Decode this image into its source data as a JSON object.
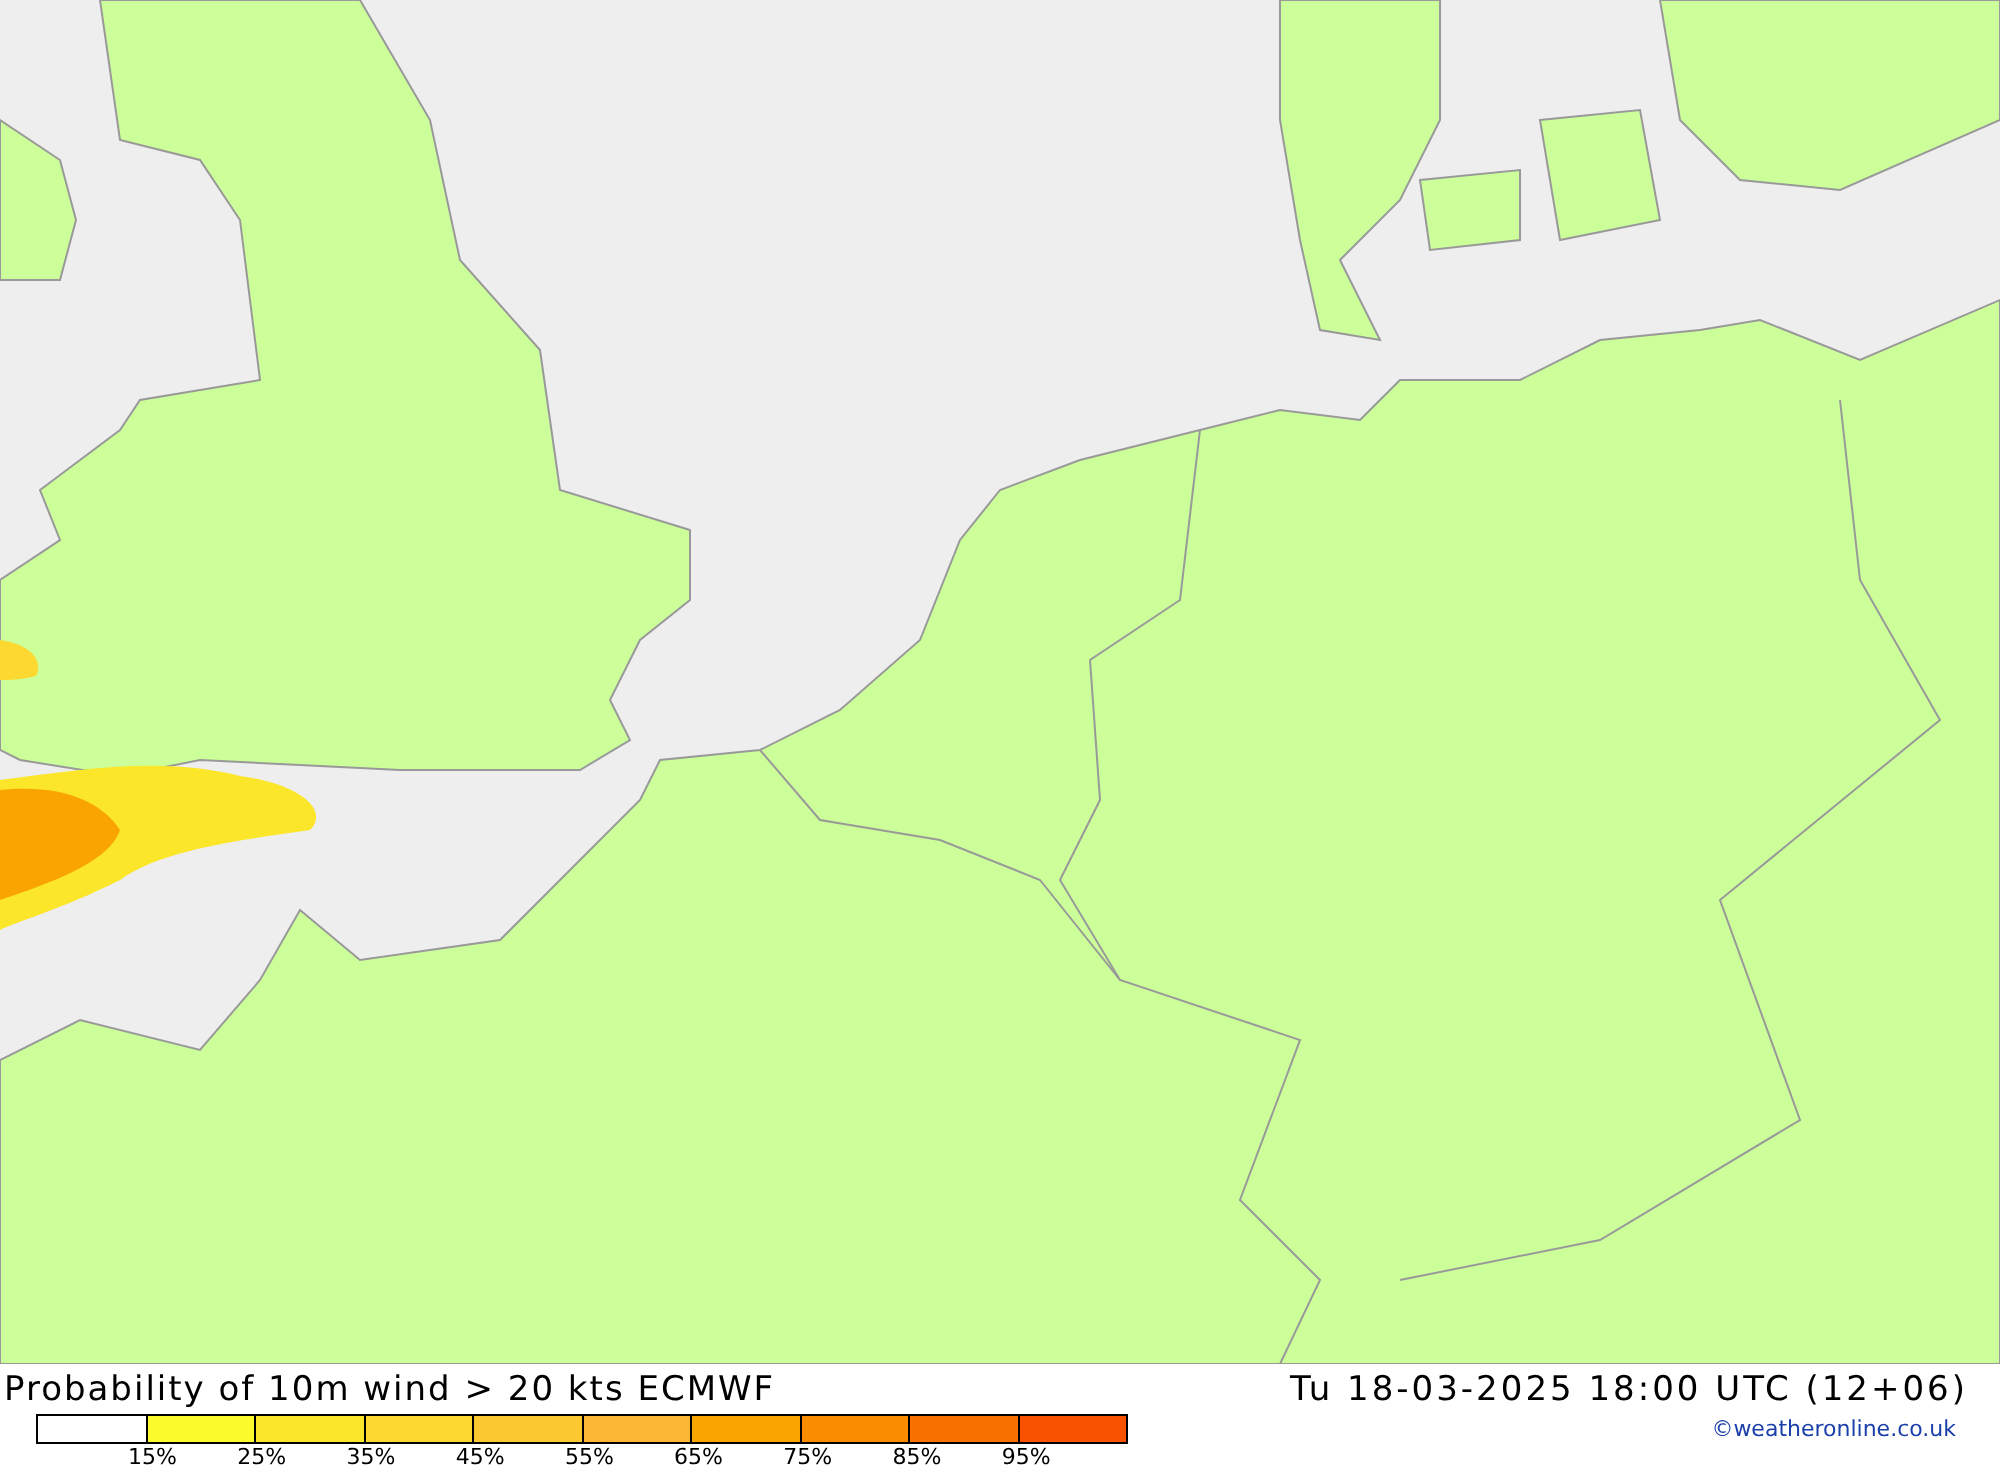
{
  "title": "Probability of 10m wind > 20 kts ECMWF",
  "valid_time": "Tu 18-03-2025 18:00 UTC (12+06)",
  "legend": [
    {
      "color": "#ffffff"
    },
    {
      "color": "#fafa2c",
      "label": "15%"
    },
    {
      "color": "#fbe62a",
      "label": "25%"
    },
    {
      "color": "#fdd830",
      "label": "35%"
    },
    {
      "color": "#fcc832",
      "label": "45%"
    },
    {
      "color": "#fbb633",
      "label": "55%"
    },
    {
      "color": "#f9a400",
      "label": "65%"
    },
    {
      "color": "#f98c00",
      "label": "75%"
    },
    {
      "color": "#f87200",
      "label": "85%"
    },
    {
      "color": "#f85200",
      "label": "95%"
    }
  ],
  "credit": "©weatheronline.co.uk"
}
